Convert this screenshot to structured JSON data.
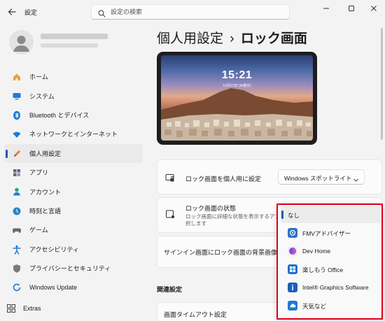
{
  "window": {
    "app_title": "設定",
    "search_placeholder": "設定の検索"
  },
  "profile": {
    "avatar_icon": "person-icon"
  },
  "sidebar": {
    "items": [
      {
        "label": "ホーム",
        "icon": "home-icon",
        "color": "#e8a33d"
      },
      {
        "label": "システム",
        "icon": "monitor-icon",
        "color": "#1f7ad6"
      },
      {
        "label": "Bluetooth とデバイス",
        "icon": "bluetooth-icon",
        "color": "#1f7ad6"
      },
      {
        "label": "ネットワークとインターネット",
        "icon": "wifi-icon",
        "color": "#1f7ad6"
      },
      {
        "label": "個人用設定",
        "icon": "pencil-icon",
        "color": "#e07a2c",
        "active": true
      },
      {
        "label": "アプリ",
        "icon": "apps-icon",
        "color": "#5c6a7c"
      },
      {
        "label": "アカウント",
        "icon": "account-icon",
        "color": "#2ba07a"
      },
      {
        "label": "時刻と言語",
        "icon": "globe-clock-icon",
        "color": "#2a86c8"
      },
      {
        "label": "ゲーム",
        "icon": "gamepad-icon",
        "color": "#6b6b6b"
      },
      {
        "label": "アクセシビリティ",
        "icon": "accessibility-icon",
        "color": "#1f7ad6"
      },
      {
        "label": "プライバシーとセキュリティ",
        "icon": "shield-icon",
        "color": "#7a7a7a"
      },
      {
        "label": "Windows Update",
        "icon": "update-icon",
        "color": "#1f7ad6"
      }
    ],
    "extras_label": "Extras"
  },
  "main": {
    "breadcrumb_parent": "個人用設定",
    "breadcrumb_sep": "›",
    "breadcrumb_current": "ロック画面",
    "preview_time": "15:21",
    "preview_date": "11月27日 (水曜日)",
    "lock_personalize_label": "ロック画面を個人用に設定",
    "lock_personalize_value": "Windows スポットライト",
    "lock_status_label": "ロック画面の状態",
    "lock_status_desc1": "ロック画面に詳細な状態を表示するアプ",
    "lock_status_desc2": "択します",
    "signin_bg_label": "サインイン画面にロック画面の背景画像を表",
    "related_title": "関連設定",
    "timeout_label": "画面タイムアウト設定"
  },
  "popup": {
    "items": [
      {
        "label": "なし",
        "icon": "",
        "selected": true
      },
      {
        "label": "FMVアドバイザー",
        "icon": "fmv-advisor-icon",
        "color": "#2a74c9"
      },
      {
        "label": "Dev Home",
        "icon": "dev-home-icon",
        "color": "#7a4fd1"
      },
      {
        "label": "楽しもう Office",
        "icon": "office-icon",
        "color": "#1f6fd1"
      },
      {
        "label": "Intel® Graphics Software",
        "icon": "intel-icon",
        "color": "#1d5fb8"
      },
      {
        "label": "天気など",
        "icon": "weather-icon",
        "color": "#1f7ad6"
      }
    ]
  },
  "colors": {
    "accent": "#005fb8",
    "highlight": "#e2001a"
  }
}
